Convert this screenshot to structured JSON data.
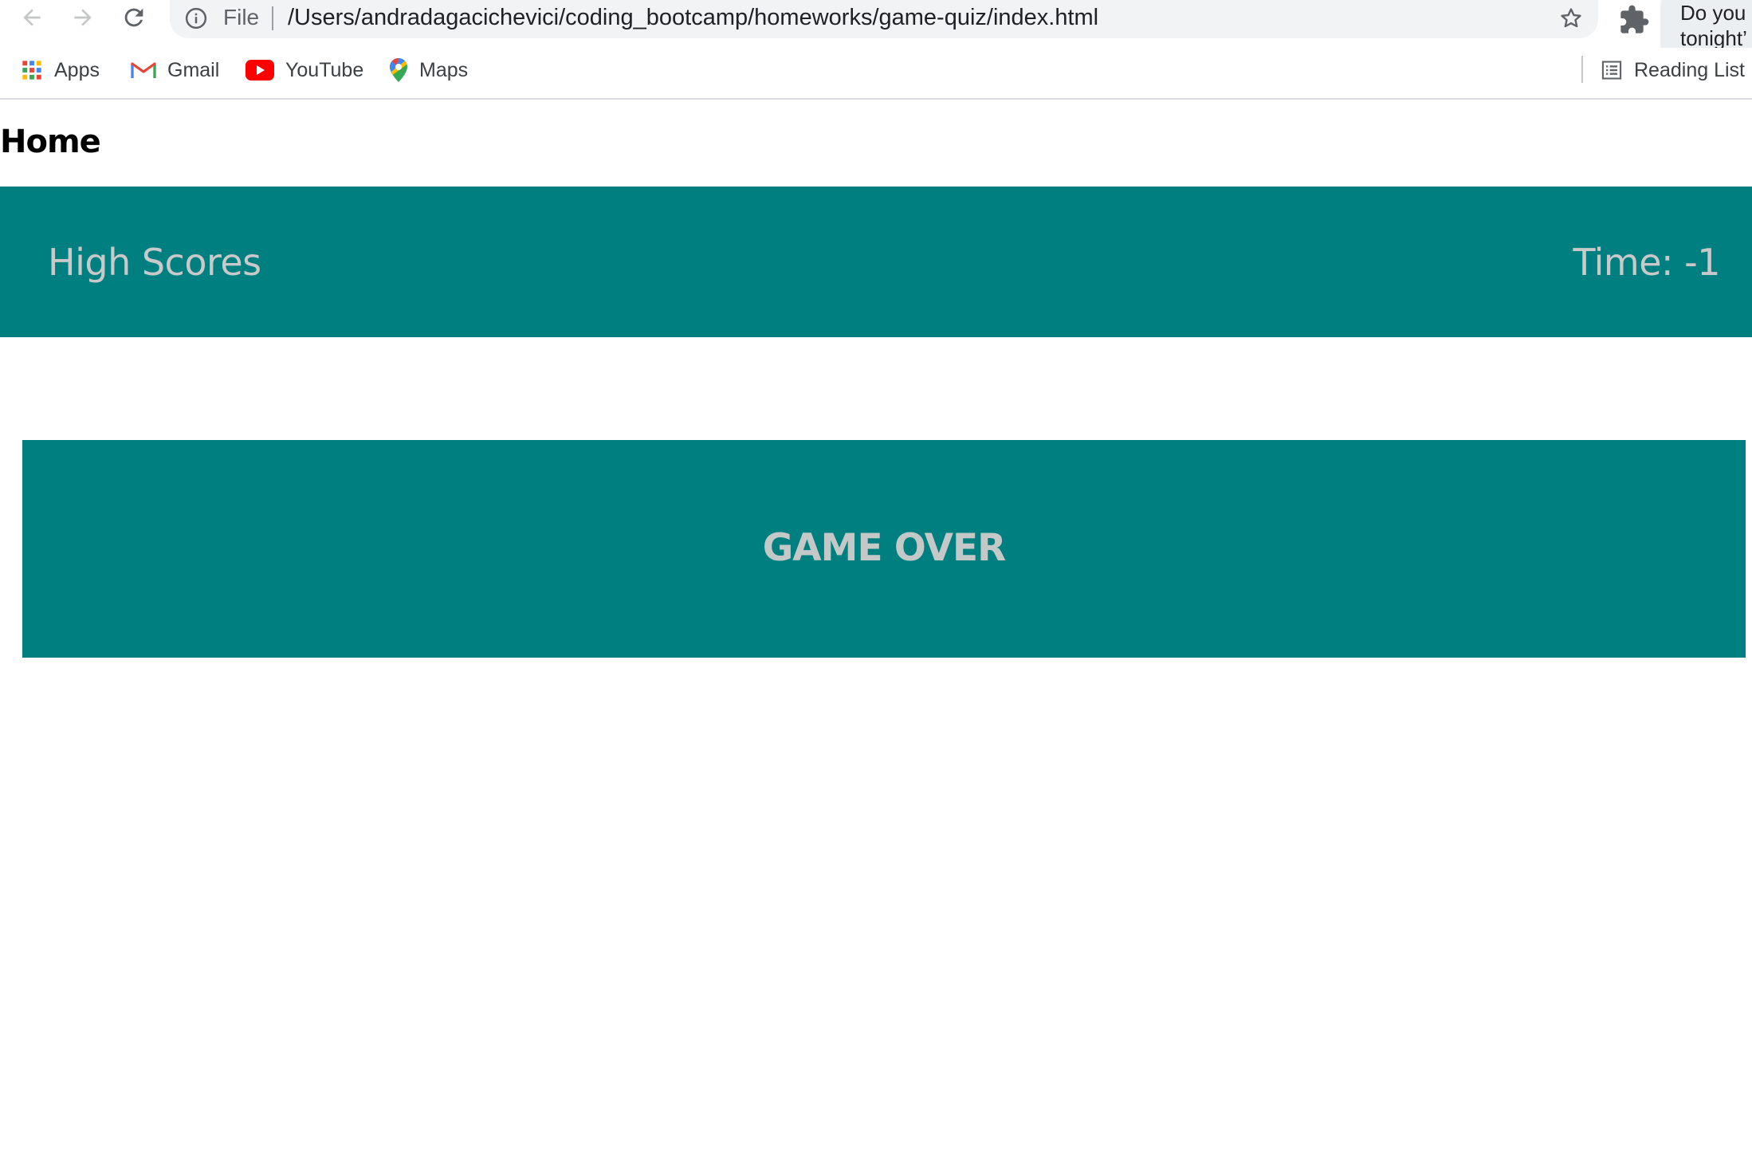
{
  "browser": {
    "address_bar": {
      "scheme": "File",
      "url": "/Users/andradagacichevici/coding_bootcamp/homeworks/game-quiz/index.html"
    },
    "popup_text": "Do you\ntonight’",
    "bookmarks": [
      {
        "label": "Apps",
        "icon": "apps-grid-icon"
      },
      {
        "label": "Gmail",
        "icon": "gmail-icon"
      },
      {
        "label": "YouTube",
        "icon": "youtube-icon"
      },
      {
        "label": "Maps",
        "icon": "maps-icon"
      }
    ],
    "reading_list_label": "Reading List"
  },
  "page": {
    "home_label": "Home",
    "header": {
      "high_scores_label": "High Scores",
      "timer_text": "Time: -1"
    },
    "game_over_text": "GAME OVER"
  },
  "colors": {
    "teal": "#007f80",
    "muted_text": "#c9c9c9"
  }
}
